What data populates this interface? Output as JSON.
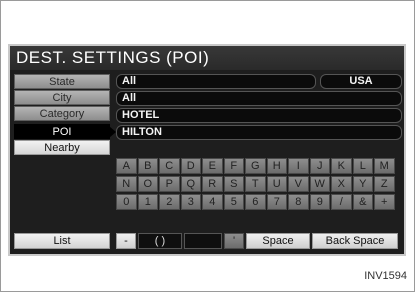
{
  "screen": {
    "title": "DEST. SETTINGS (POI)",
    "side_buttons": [
      {
        "label": "State"
      },
      {
        "label": "City"
      },
      {
        "label": "Category"
      },
      {
        "label": "POI"
      },
      {
        "label": "Nearby"
      }
    ],
    "fields": {
      "state_value": "All",
      "country_value": "USA",
      "city_value": "All",
      "category_value": "HOTEL",
      "poi_value": "HILTON"
    },
    "keyboard": {
      "rows": [
        [
          "A",
          "B",
          "C",
          "D",
          "E",
          "F",
          "G",
          "H",
          "I",
          "J",
          "K",
          "L",
          "M"
        ],
        [
          "N",
          "O",
          "P",
          "Q",
          "R",
          "S",
          "T",
          "U",
          "V",
          "W",
          "X",
          "Y",
          "Z"
        ],
        [
          "0",
          "1",
          "2",
          "3",
          "4",
          "5",
          "6",
          "7",
          "8",
          "9",
          "/",
          "&",
          "+"
        ]
      ],
      "bottom": {
        "dash": "-",
        "parens": "(  )",
        "apostrophe": "'",
        "space": "Space",
        "back_space": "Back  Space"
      }
    },
    "list_button": "List"
  },
  "figure_code": "INV1594"
}
